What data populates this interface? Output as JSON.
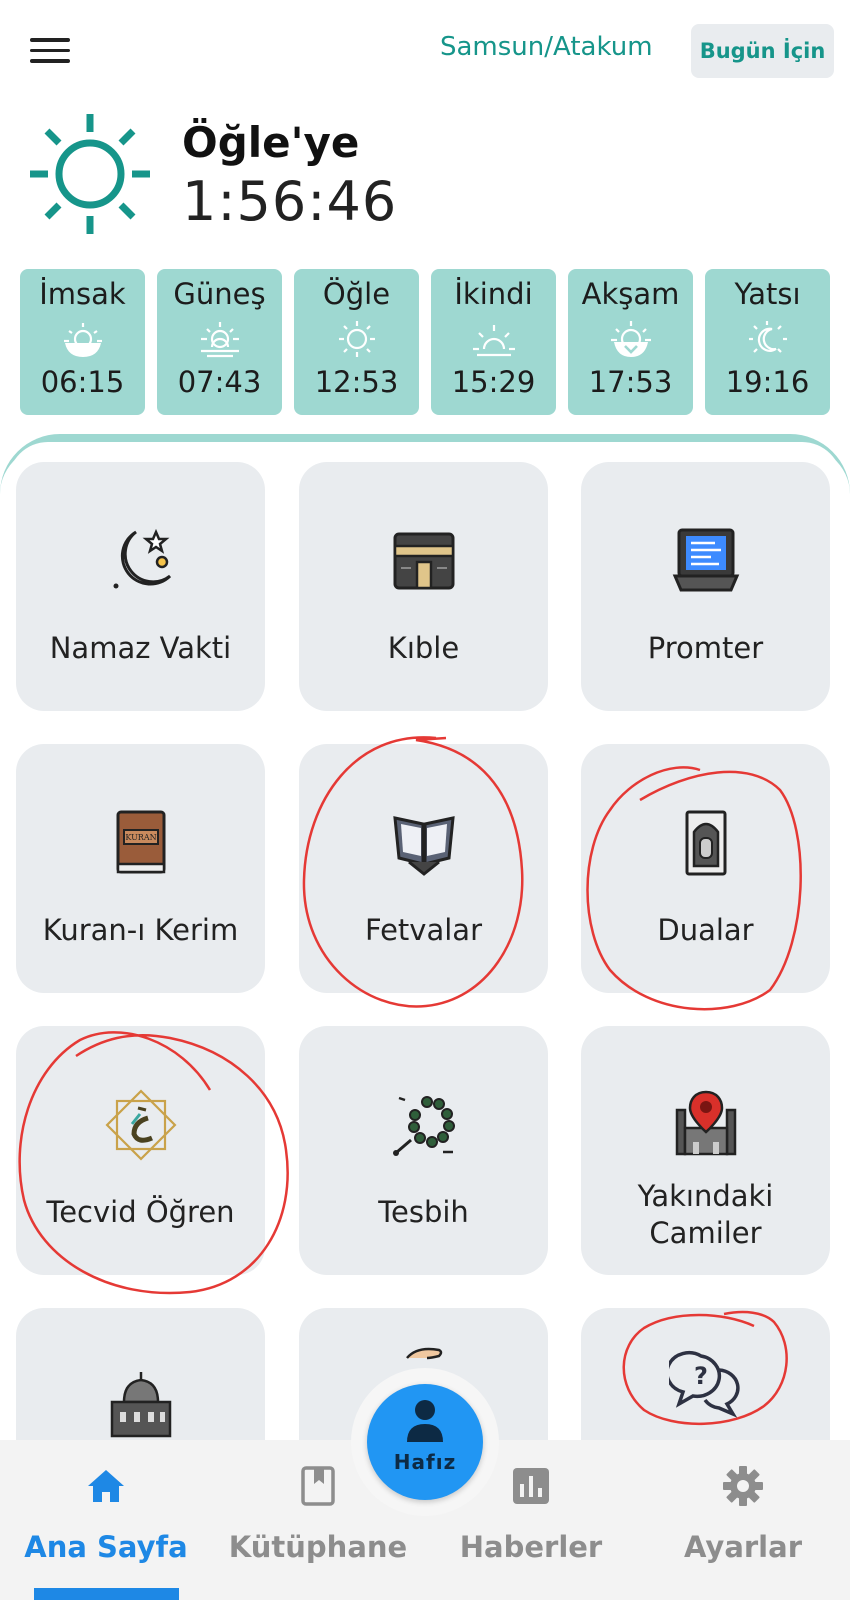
{
  "header": {
    "menu_icon": "hamburger-icon",
    "location": "Samsun/Atakum",
    "today_button": "Bugün İçin"
  },
  "countdown": {
    "icon": "sun-icon",
    "next_prayer_label": "Öğle'ye",
    "remaining_time": "1:56:46"
  },
  "prayer_times": [
    {
      "name": "İmsak",
      "time": "06:15",
      "icon": "sunrise-half-icon"
    },
    {
      "name": "Güneş",
      "time": "07:43",
      "icon": "sun-horizon-icon"
    },
    {
      "name": "Öğle",
      "time": "12:53",
      "icon": "sun-icon"
    },
    {
      "name": "İkindi",
      "time": "15:29",
      "icon": "sun-low-icon"
    },
    {
      "name": "Akşam",
      "time": "17:53",
      "icon": "sunset-icon"
    },
    {
      "name": "Yatsı",
      "time": "19:16",
      "icon": "moon-icon"
    }
  ],
  "tiles": [
    {
      "label": "Namaz Vakti",
      "icon": "crescent-moon-star-icon"
    },
    {
      "label": "Kıble",
      "icon": "kaaba-icon"
    },
    {
      "label": "Promter",
      "icon": "teleprompter-icon"
    },
    {
      "label": "Kuran-ı Kerim",
      "icon": "quran-book-icon"
    },
    {
      "label": "Fetvalar",
      "icon": "open-book-stand-icon"
    },
    {
      "label": "Dualar",
      "icon": "prayer-rug-icon"
    },
    {
      "label": "Tecvid Öğren",
      "icon": "calligraphy-icon"
    },
    {
      "label": "Tesbih",
      "icon": "prayer-beads-icon"
    },
    {
      "label": "Yakındaki Camiler",
      "icon": "mosque-location-icon"
    },
    {
      "label": "",
      "icon": "mosque-icon"
    },
    {
      "label": "",
      "icon": "hand-icon"
    },
    {
      "label": "",
      "icon": "question-chat-icon"
    }
  ],
  "fab": {
    "label": "Hafız",
    "icon": "person-icon"
  },
  "bottom_nav": [
    {
      "label": "Ana Sayfa",
      "icon": "home-icon",
      "active": true
    },
    {
      "label": "Kütüphane",
      "icon": "bookmark-book-icon",
      "active": false
    },
    {
      "label": "Haberler",
      "icon": "bar-chart-icon",
      "active": false
    },
    {
      "label": "Ayarlar",
      "icon": "gear-icon",
      "active": false
    }
  ],
  "colors": {
    "accent_teal": "#16958a",
    "card_teal": "#9ed8d1",
    "tile_gray": "#e9ecef",
    "active_blue": "#1e88e5",
    "annotation_red": "#e53935"
  }
}
